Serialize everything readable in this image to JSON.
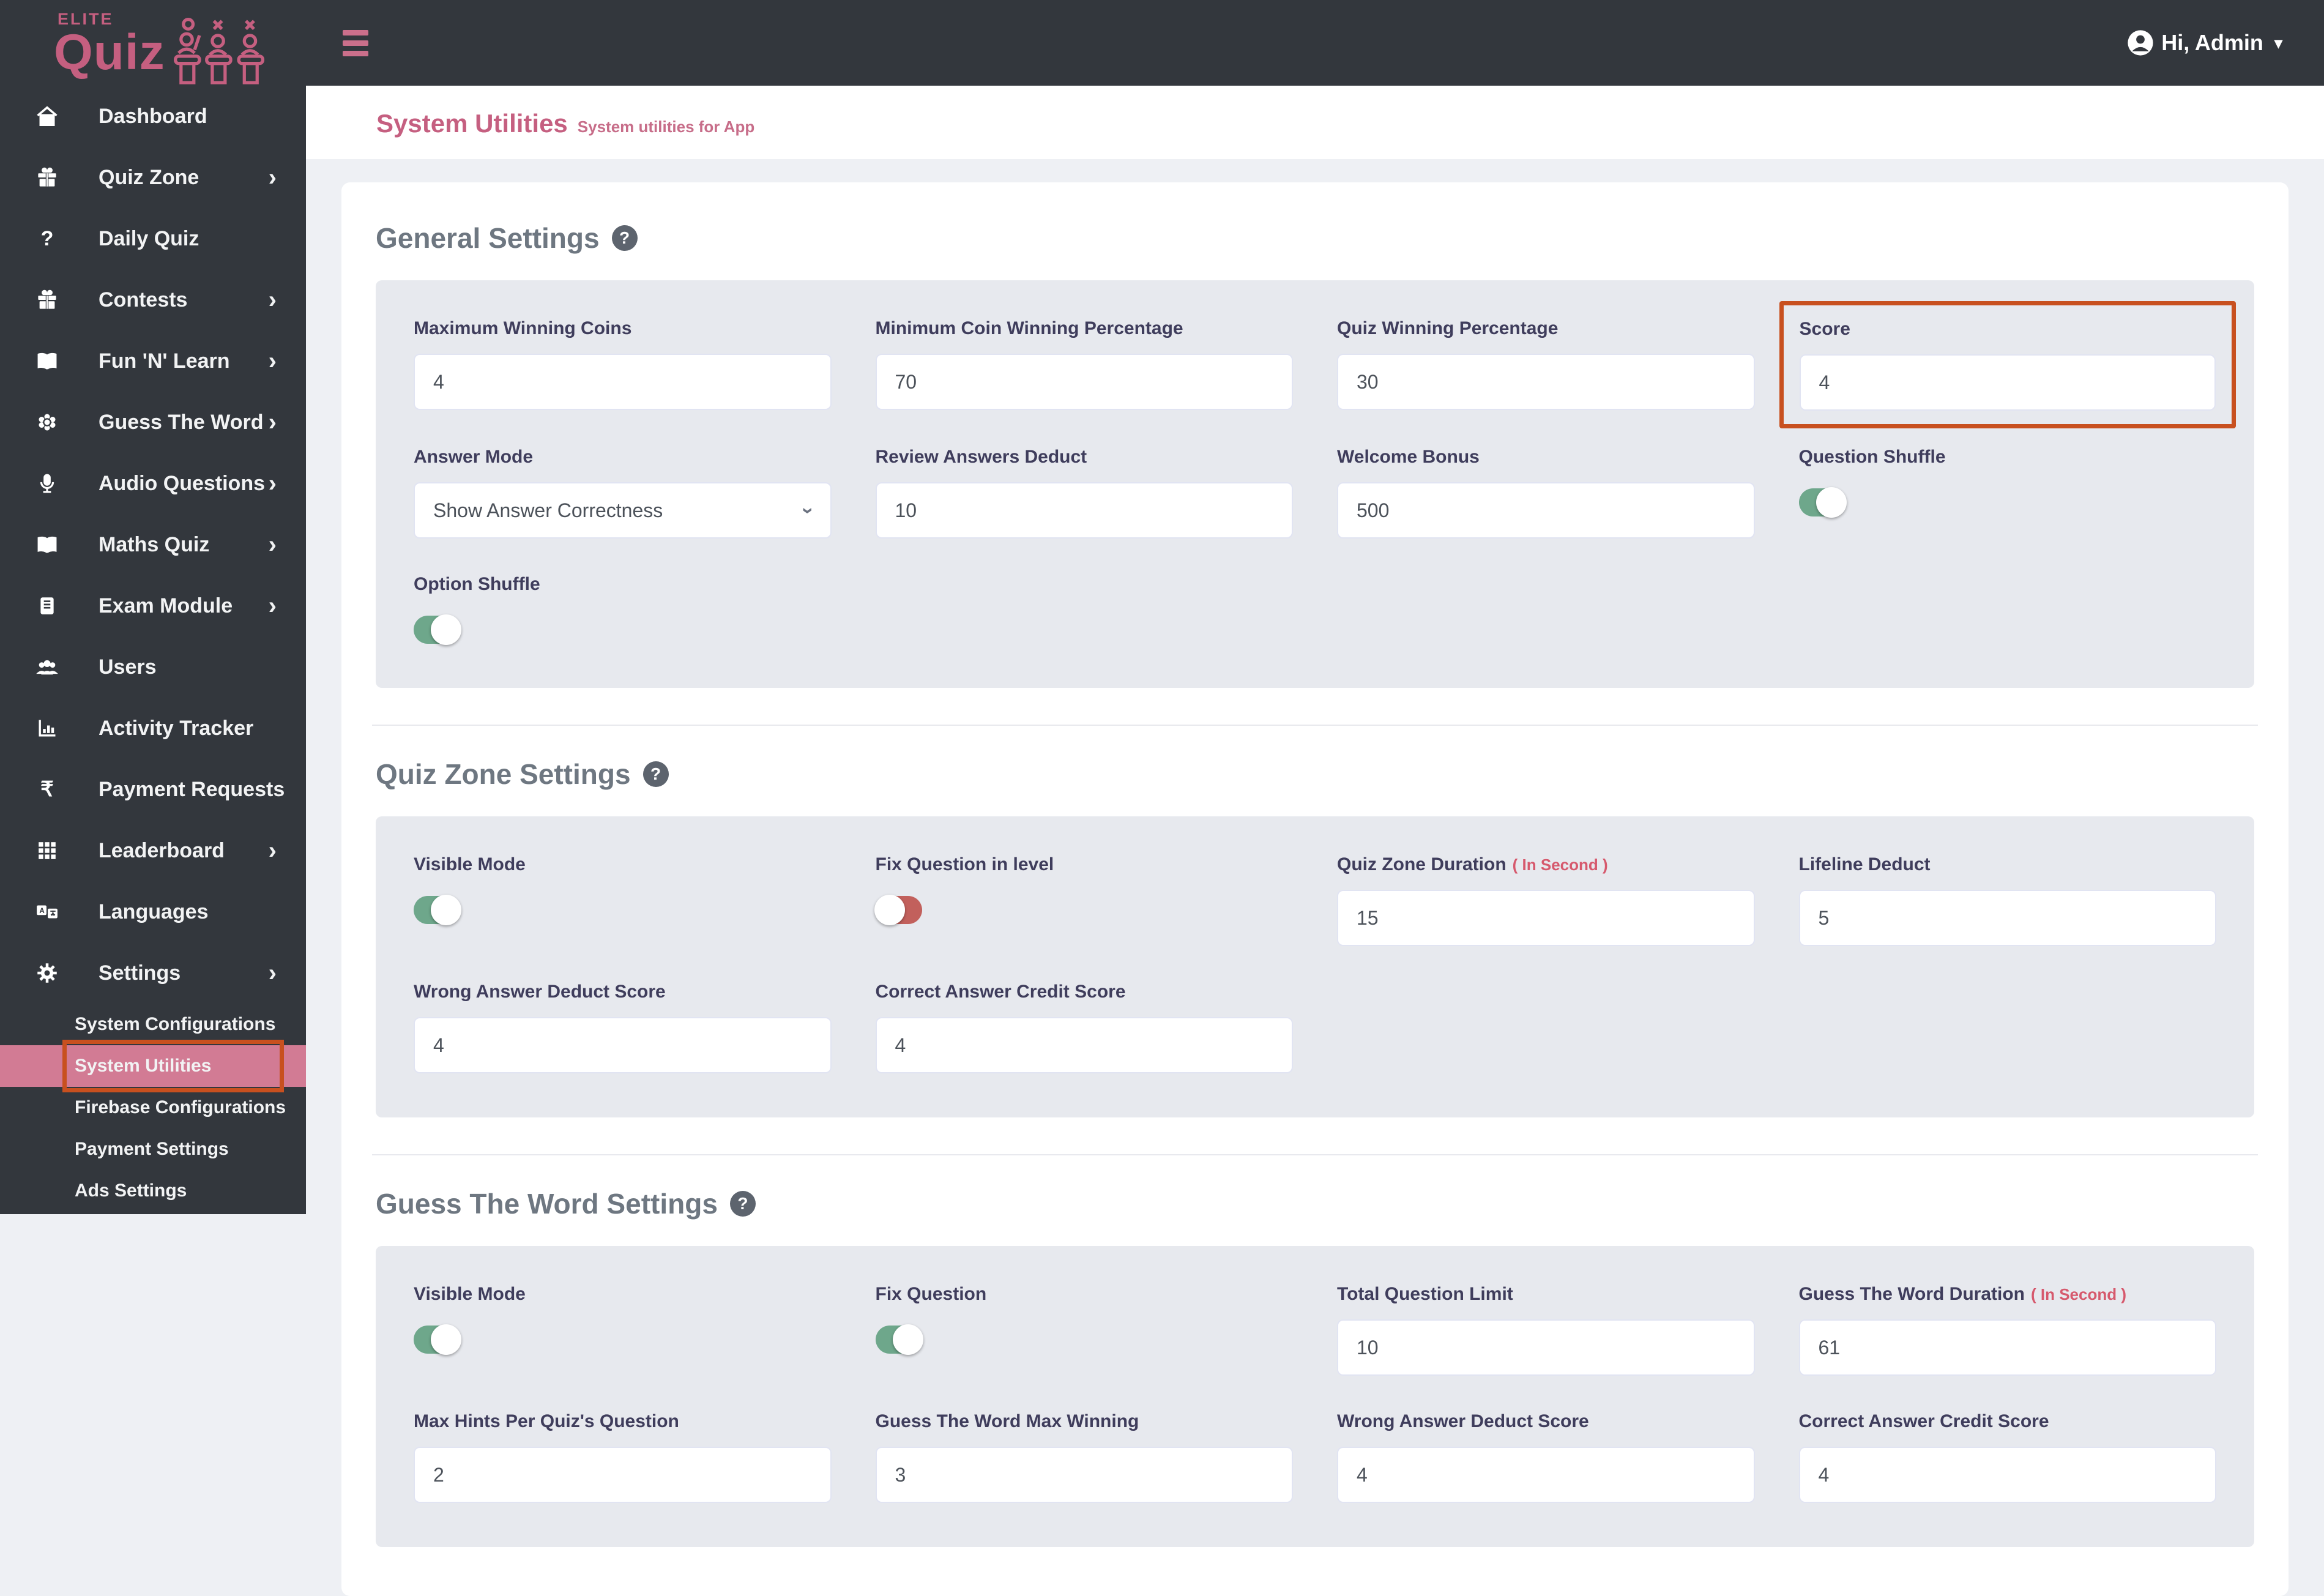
{
  "brand": {
    "elite": "ELITE",
    "quiz": "Quiz"
  },
  "header": {
    "user_label": "Hi, Admin"
  },
  "icons": {
    "chevron_right": "›",
    "caret_down": "▾",
    "help": "?",
    "question": "?",
    "rupee": "₹"
  },
  "colors": {
    "accent_pink": "#c55f80",
    "sidebar_bg": "#33373d",
    "active_band_pink": "#d27b94",
    "highlight_orange": "#c8501f",
    "toggle_on_green": "#6ea78b",
    "toggle_off_red": "#c2605c",
    "panel_gray": "#e7e9ee"
  },
  "sidebar": {
    "items": [
      {
        "label": "Dashboard"
      },
      {
        "label": "Quiz Zone"
      },
      {
        "label": "Daily Quiz"
      },
      {
        "label": "Contests"
      },
      {
        "label": "Fun 'N' Learn"
      },
      {
        "label": "Guess The Word"
      },
      {
        "label": "Audio Questions"
      },
      {
        "label": "Maths Quiz"
      },
      {
        "label": "Exam Module"
      },
      {
        "label": "Users"
      },
      {
        "label": "Activity Tracker"
      },
      {
        "label": "Payment Requests"
      },
      {
        "label": "Leaderboard"
      },
      {
        "label": "Languages"
      },
      {
        "label": "Settings"
      }
    ],
    "submenu": [
      {
        "label": "System Configurations"
      },
      {
        "label": "System Utilities"
      },
      {
        "label": "Firebase Configurations"
      },
      {
        "label": "Payment Settings"
      },
      {
        "label": "Ads  Settings"
      }
    ]
  },
  "page": {
    "title": "System Utilities",
    "subtitle": "System utilities for App"
  },
  "sections": [
    {
      "title": "General Settings",
      "fields": [
        {
          "label": "Maximum Winning Coins",
          "value": "4"
        },
        {
          "label": "Minimum Coin Winning Percentage",
          "value": "70"
        },
        {
          "label": "Quiz Winning Percentage",
          "value": "30"
        },
        {
          "label": "Score",
          "value": "4"
        },
        {
          "label": "Answer Mode",
          "value": "Show Answer Correctness"
        },
        {
          "label": "Review Answers Deduct",
          "value": "10"
        },
        {
          "label": "Welcome Bonus",
          "value": "500"
        },
        {
          "label": "Question Shuffle",
          "state": "on"
        },
        {
          "label": "Option Shuffle",
          "state": "on"
        }
      ]
    },
    {
      "title": "Quiz Zone Settings",
      "fields": [
        {
          "label": "Visible Mode",
          "state": "on"
        },
        {
          "label": "Fix Question in level",
          "state": "off"
        },
        {
          "label": "Quiz Zone Duration",
          "note": "( In Second )",
          "value": "15"
        },
        {
          "label": "Lifeline Deduct",
          "value": "5"
        },
        {
          "label": "Wrong Answer Deduct Score",
          "value": "4"
        },
        {
          "label": "Correct Answer Credit Score",
          "value": "4"
        }
      ]
    },
    {
      "title": "Guess The Word Settings",
      "fields": [
        {
          "label": "Visible Mode",
          "state": "on"
        },
        {
          "label": "Fix Question",
          "state": "on"
        },
        {
          "label": "Total Question Limit",
          "value": "10"
        },
        {
          "label": "Guess The Word Duration",
          "note": "( In Second )",
          "value": "61"
        },
        {
          "label": "Max Hints Per Quiz's Question",
          "value": "2"
        },
        {
          "label": "Guess The Word Max Winning",
          "value": "3"
        },
        {
          "label": "Wrong Answer Deduct Score",
          "value": "4"
        },
        {
          "label": "Correct Answer Credit Score",
          "value": "4"
        }
      ]
    }
  ]
}
